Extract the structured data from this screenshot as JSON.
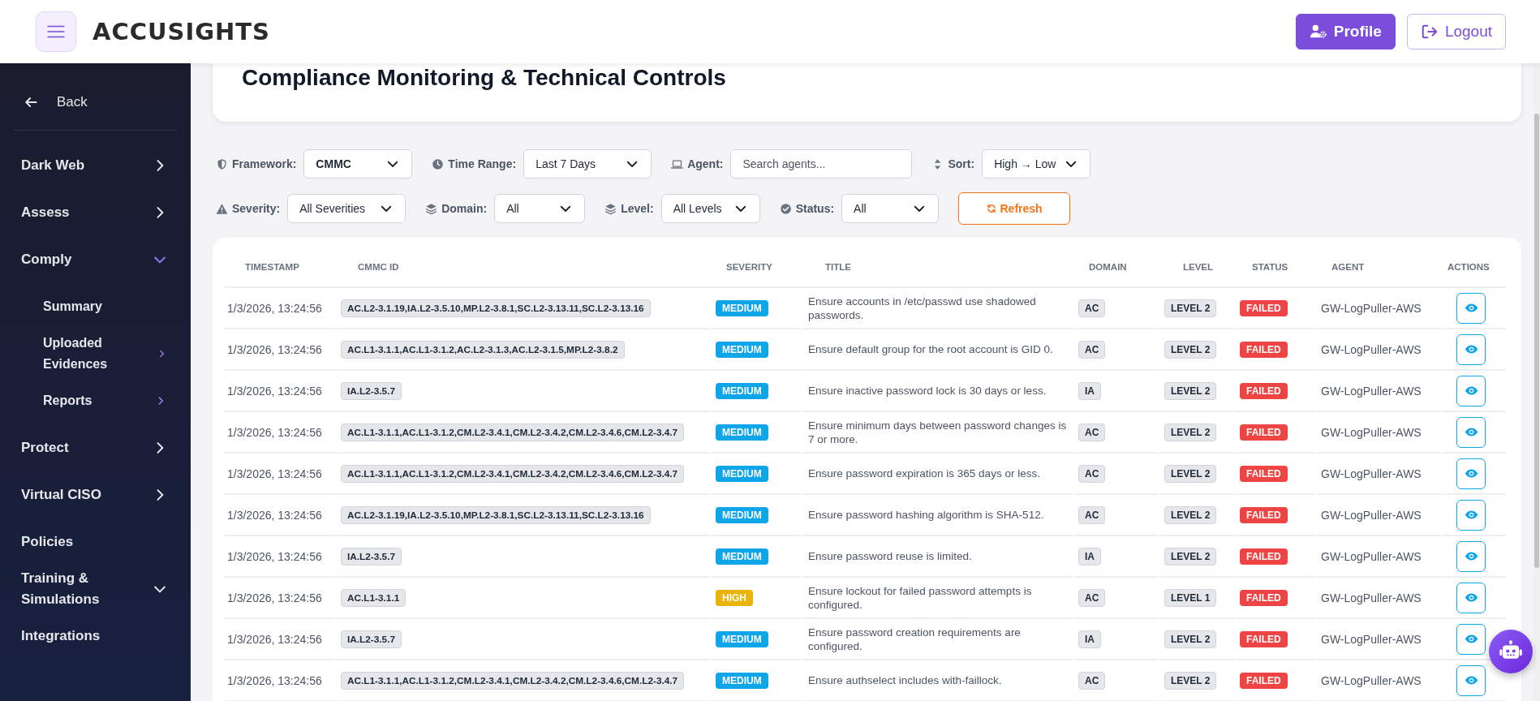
{
  "header": {
    "logo": "ACCUSIGHTS",
    "buttons": [
      {
        "label": "Profile",
        "kind": "primary"
      },
      {
        "label": "Logout",
        "kind": "outline"
      }
    ]
  },
  "sidebar": {
    "back": "Back",
    "items": [
      {
        "label": "Dark Web",
        "expandable": true,
        "expanded": false,
        "active": false
      },
      {
        "label": "Assess",
        "expandable": true,
        "expanded": false,
        "active": false
      },
      {
        "label": "Comply",
        "expandable": true,
        "expanded": true,
        "active": true,
        "children": [
          {
            "label": "Summary",
            "expandable": false
          },
          {
            "label": "Uploaded Evidences",
            "expandable": true
          },
          {
            "label": "Reports",
            "expandable": true
          }
        ]
      },
      {
        "label": "Protect",
        "expandable": true,
        "expanded": false,
        "active": false
      },
      {
        "label": "Virtual CISO",
        "expandable": true,
        "expanded": false,
        "active": false
      },
      {
        "label": "Policies",
        "expandable": false
      },
      {
        "label": "Training & Simulations",
        "expandable": true,
        "expanded": true,
        "active": false
      },
      {
        "label": "Integrations"
      }
    ]
  },
  "page_title": "Compliance Monitoring & Technical Controls",
  "filter_rows": [
    [
      {
        "kind": "select",
        "label": "Framework:",
        "value": "CMMC"
      },
      {
        "kind": "select",
        "label": "Time Range:",
        "value": "Last 7 Days"
      },
      {
        "kind": "input",
        "label": "Agent:",
        "placeholder": "Search agents..."
      },
      {
        "kind": "select",
        "label": "Sort:",
        "value": "High → Low"
      }
    ],
    [
      {
        "kind": "select",
        "label": "Severity:",
        "value": "All Severities"
      },
      {
        "kind": "select",
        "label": "Domain:",
        "value": "All"
      },
      {
        "kind": "select",
        "label": "Level:",
        "value": "All Levels"
      },
      {
        "kind": "select",
        "label": "Status:",
        "value": "All"
      },
      {
        "kind": "button",
        "label": "Refresh"
      }
    ]
  ],
  "table": {
    "columns": [
      "TIMESTAMP",
      "CMMC ID",
      "SEVERITY",
      "TITLE",
      "DOMAIN",
      "LEVEL",
      "STATUS",
      "AGENT",
      "ACTIONS"
    ],
    "rows": [
      {
        "timestamp": "1/3/2026, 13:24:56",
        "cmmc_id": "AC.L2-3.1.19,IA.L2-3.5.10,MP.L2-3.8.1,SC.L2-3.13.11,SC.L2-3.13.16",
        "severity": {
          "text": "MEDIUM",
          "color": "#0ea5e9"
        },
        "title": "Ensure accounts in /etc/passwd use shadowed passwords.",
        "domain": "AC",
        "level": "LEVEL 2",
        "status": {
          "text": "FAILED",
          "color": "#ef4444"
        },
        "agent": "GW-LogPuller-AWS"
      },
      {
        "timestamp": "1/3/2026, 13:24:56",
        "cmmc_id": "AC.L1-3.1.1,AC.L1-3.1.2,AC.L2-3.1.3,AC.L2-3.1.5,MP.L2-3.8.2",
        "severity": {
          "text": "MEDIUM",
          "color": "#0ea5e9"
        },
        "title": "Ensure default group for the root account is GID 0.",
        "domain": "AC",
        "level": "LEVEL 2",
        "status": {
          "text": "FAILED",
          "color": "#ef4444"
        },
        "agent": "GW-LogPuller-AWS"
      },
      {
        "timestamp": "1/3/2026, 13:24:56",
        "cmmc_id": "IA.L2-3.5.7",
        "severity": {
          "text": "MEDIUM",
          "color": "#0ea5e9"
        },
        "title": "Ensure inactive password lock is 30 days or less.",
        "domain": "IA",
        "level": "LEVEL 2",
        "status": {
          "text": "FAILED",
          "color": "#ef4444"
        },
        "agent": "GW-LogPuller-AWS"
      },
      {
        "timestamp": "1/3/2026, 13:24:56",
        "cmmc_id": "AC.L1-3.1.1,AC.L1-3.1.2,CM.L2-3.4.1,CM.L2-3.4.2,CM.L2-3.4.6,CM.L2-3.4.7",
        "severity": {
          "text": "MEDIUM",
          "color": "#0ea5e9"
        },
        "title": "Ensure minimum days between password changes is 7 or more.",
        "domain": "AC",
        "level": "LEVEL 2",
        "status": {
          "text": "FAILED",
          "color": "#ef4444"
        },
        "agent": "GW-LogPuller-AWS"
      },
      {
        "timestamp": "1/3/2026, 13:24:56",
        "cmmc_id": "AC.L1-3.1.1,AC.L1-3.1.2,CM.L2-3.4.1,CM.L2-3.4.2,CM.L2-3.4.6,CM.L2-3.4.7",
        "severity": {
          "text": "MEDIUM",
          "color": "#0ea5e9"
        },
        "title": "Ensure password expiration is 365 days or less.",
        "domain": "AC",
        "level": "LEVEL 2",
        "status": {
          "text": "FAILED",
          "color": "#ef4444"
        },
        "agent": "GW-LogPuller-AWS"
      },
      {
        "timestamp": "1/3/2026, 13:24:56",
        "cmmc_id": "AC.L2-3.1.19,IA.L2-3.5.10,MP.L2-3.8.1,SC.L2-3.13.11,SC.L2-3.13.16",
        "severity": {
          "text": "MEDIUM",
          "color": "#0ea5e9"
        },
        "title": "Ensure password hashing algorithm is SHA-512.",
        "domain": "AC",
        "level": "LEVEL 2",
        "status": {
          "text": "FAILED",
          "color": "#ef4444"
        },
        "agent": "GW-LogPuller-AWS"
      },
      {
        "timestamp": "1/3/2026, 13:24:56",
        "cmmc_id": "IA.L2-3.5.7",
        "severity": {
          "text": "MEDIUM",
          "color": "#0ea5e9"
        },
        "title": "Ensure password reuse is limited.",
        "domain": "IA",
        "level": "LEVEL 2",
        "status": {
          "text": "FAILED",
          "color": "#ef4444"
        },
        "agent": "GW-LogPuller-AWS"
      },
      {
        "timestamp": "1/3/2026, 13:24:56",
        "cmmc_id": "AC.L1-3.1.1",
        "severity": {
          "text": "HIGH",
          "color": "#eab308"
        },
        "title": "Ensure lockout for failed password attempts is configured.",
        "domain": "AC",
        "level": "LEVEL 1",
        "status": {
          "text": "FAILED",
          "color": "#ef4444"
        },
        "agent": "GW-LogPuller-AWS"
      },
      {
        "timestamp": "1/3/2026, 13:24:56",
        "cmmc_id": "IA.L2-3.5.7",
        "severity": {
          "text": "MEDIUM",
          "color": "#0ea5e9"
        },
        "title": "Ensure password creation requirements are configured.",
        "domain": "IA",
        "level": "LEVEL 2",
        "status": {
          "text": "FAILED",
          "color": "#ef4444"
        },
        "agent": "GW-LogPuller-AWS"
      },
      {
        "timestamp": "1/3/2026, 13:24:56",
        "cmmc_id": "AC.L1-3.1.1,AC.L1-3.1.2,CM.L2-3.4.1,CM.L2-3.4.2,CM.L2-3.4.6,CM.L2-3.4.7",
        "severity": {
          "text": "MEDIUM",
          "color": "#0ea5e9"
        },
        "title": "Ensure authselect includes with-faillock.",
        "domain": "AC",
        "level": "LEVEL 2",
        "status": {
          "text": "FAILED",
          "color": "#ef4444"
        },
        "agent": "GW-LogPuller-AWS"
      }
    ]
  }
}
